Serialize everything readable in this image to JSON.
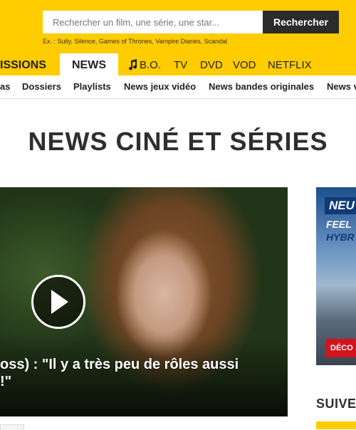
{
  "search": {
    "placeholder": "Rechercher un film, une série, une star...",
    "button_label": "Rechercher",
    "examples": "Ex. : Sully, Silence, Games of Thrones, Vampire Diaries, Scandal"
  },
  "main_nav": {
    "items": [
      "ISSIONS",
      "NEWS",
      "B.O.",
      "TV",
      "DVD",
      "VOD",
      "NETFLIX"
    ],
    "active": "NEWS"
  },
  "sub_nav": {
    "items": [
      "as",
      "Dossiers",
      "Playlists",
      "News jeux vidéo",
      "News bandes originales",
      "News v"
    ]
  },
  "page": {
    "title": "NEWS CINÉ ET SÉRIES"
  },
  "hero": {
    "caption_line1": "oss) : \"Il y a très peu de rôles aussi",
    "caption_line2": "!\""
  },
  "ad": {
    "badge": "NEU",
    "line1": "FEEL",
    "line2": "HYBR",
    "cta": "DÉCO"
  },
  "sidebar": {
    "heading": "SUIVE"
  },
  "colors": {
    "brand_yellow": "#ffcc00",
    "dark": "#2b2b2b"
  }
}
